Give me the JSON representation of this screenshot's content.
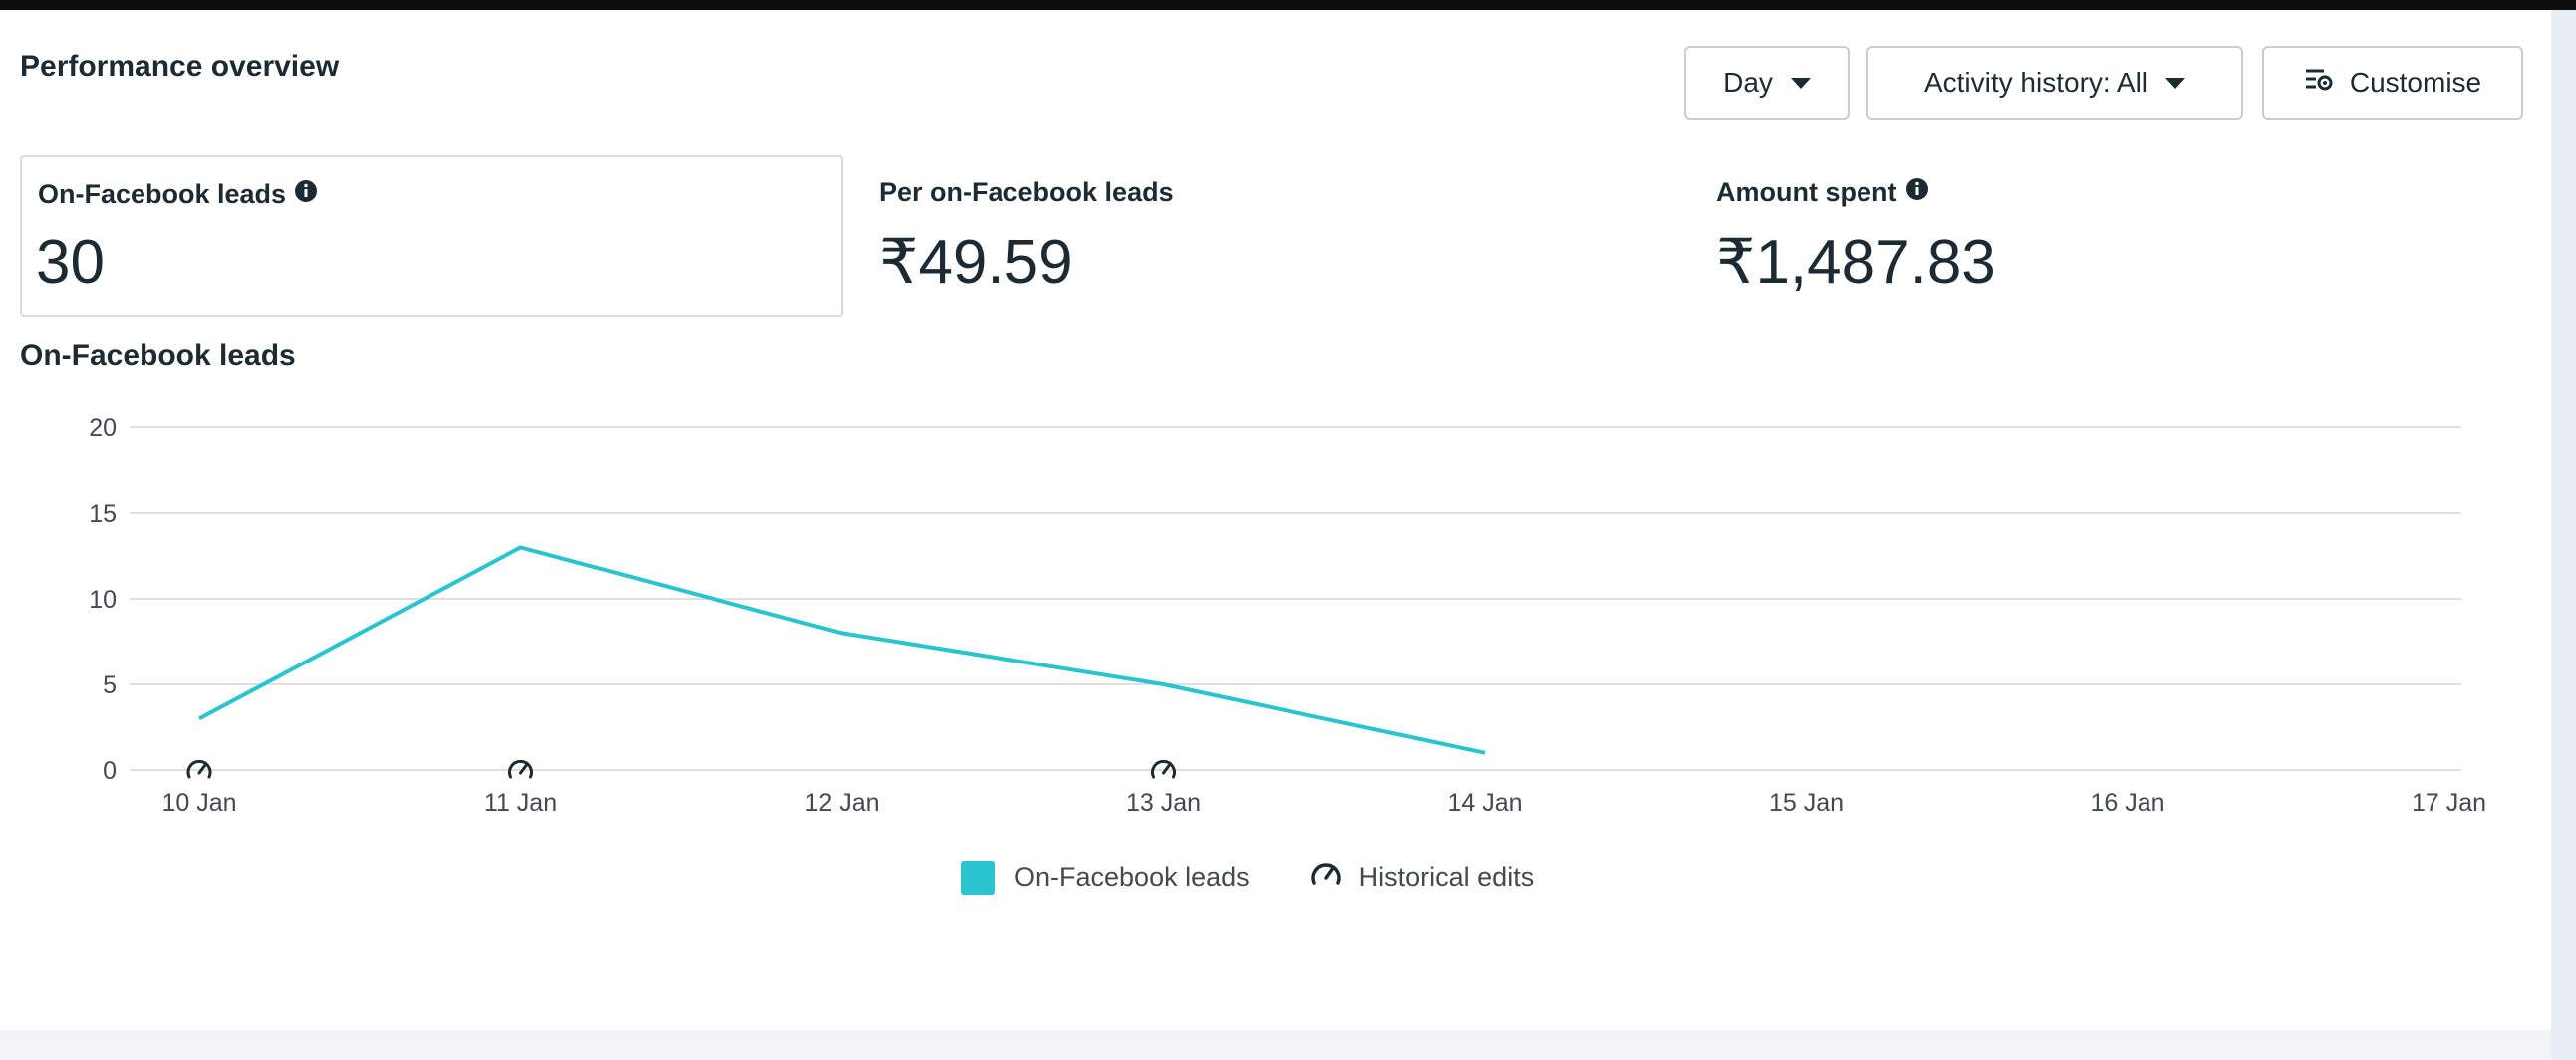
{
  "header": {
    "title": "Performance overview",
    "day_button": "Day",
    "activity_button": "Activity history: All",
    "customise_button": "Customise"
  },
  "metrics": [
    {
      "label": "On-Facebook leads",
      "value": "30",
      "has_info": true
    },
    {
      "label": "Per on-Facebook leads",
      "value": "₹49.59",
      "has_info": false
    },
    {
      "label": "Amount spent",
      "value": "₹1,487.83",
      "has_info": true
    }
  ],
  "icons": {
    "dropdown": "caret-down-icon",
    "customise": "customise-columns-icon",
    "info": "info-icon",
    "historical_edit": "speedometer-edit-icon"
  },
  "colors": {
    "series": "#29c4cd",
    "text": "#1c2b33",
    "grid": "#dddfe2"
  },
  "chart_data": {
    "type": "line",
    "title": "On-Facebook leads",
    "x": [
      "10 Jan",
      "11 Jan",
      "12 Jan",
      "13 Jan",
      "14 Jan",
      "15 Jan",
      "16 Jan",
      "17 Jan"
    ],
    "series": [
      {
        "name": "On-Facebook leads",
        "values": [
          3,
          13,
          8,
          5,
          1,
          null,
          null,
          null
        ]
      }
    ],
    "historical_edits": [
      "10 Jan",
      "11 Jan",
      "13 Jan"
    ],
    "yticks": [
      0,
      5,
      10,
      15,
      20
    ],
    "ylim": [
      0,
      20
    ],
    "grid": true,
    "legend": [
      "On-Facebook leads",
      "Historical edits"
    ],
    "legend_position": "bottom"
  }
}
